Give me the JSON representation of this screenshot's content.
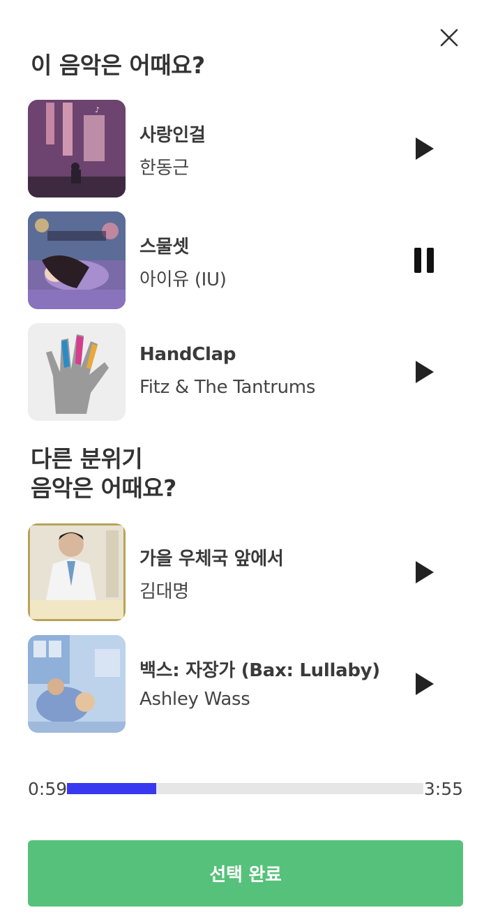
{
  "header": {
    "close_icon": "close-icon"
  },
  "section1": {
    "title": "이 음악은 어때요?"
  },
  "section2": {
    "title_line1": "다른 분위기",
    "title_line2": "음악은 어때요?"
  },
  "tracks": [
    {
      "title": "사랑인걸",
      "artist": "한동근",
      "state": "play"
    },
    {
      "title": "스물셋",
      "artist": "아이유 (IU)",
      "state": "pause"
    },
    {
      "title": "HandClap",
      "artist": "Fitz & The Tantrums",
      "state": "play"
    },
    {
      "title": "가을 우체국 앞에서",
      "artist": "김대명",
      "state": "play"
    },
    {
      "title": "백스: 자장가 (Bax: Lullaby)",
      "artist": "Ashley Wass",
      "state": "play"
    }
  ],
  "player": {
    "current_time": "0:59",
    "total_time": "3:55",
    "progress_fraction": 0.251,
    "accent_color": "#3838f0"
  },
  "footer": {
    "done_label": "선택 완료",
    "button_color": "#56c17a"
  }
}
